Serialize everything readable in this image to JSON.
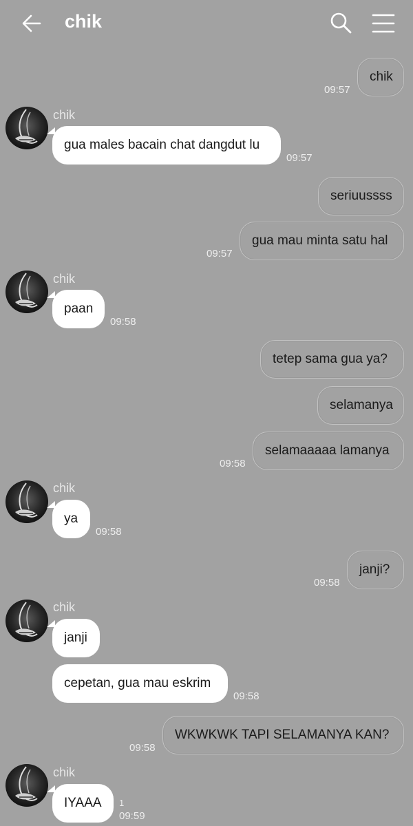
{
  "header": {
    "title": "chik"
  },
  "messages": [
    {
      "dir": "out",
      "text": "chik",
      "time": "09:57"
    },
    {
      "dir": "in",
      "sender": "chik",
      "text": "gua males bacain chat dangdut lu",
      "time": "09:57"
    },
    {
      "dir": "out",
      "text": "seriuussss",
      "time": ""
    },
    {
      "dir": "out",
      "text": "gua mau minta satu hal",
      "time": "09:57"
    },
    {
      "dir": "in",
      "sender": "chik",
      "text": "paan",
      "time": "09:58"
    },
    {
      "dir": "out",
      "text": "tetep sama gua ya?",
      "time": ""
    },
    {
      "dir": "out",
      "text": "selamanya",
      "time": ""
    },
    {
      "dir": "out",
      "text": "selamaaaaa lamanya",
      "time": "09:58"
    },
    {
      "dir": "in",
      "sender": "chik",
      "text": "ya",
      "time": "09:58"
    },
    {
      "dir": "out",
      "text": "janji?",
      "time": "09:58"
    },
    {
      "dir": "in",
      "sender": "chik",
      "text": "janji",
      "time": ""
    },
    {
      "dir": "in",
      "text": "cepetan, gua mau eskrim",
      "time": "09:58"
    },
    {
      "dir": "out",
      "text": "WKWKWK TAPI SELAMANYA KAN?",
      "time": "09:58"
    },
    {
      "dir": "in",
      "sender": "chik",
      "text": "IYAAA",
      "time": "09:59",
      "read_count": "1"
    }
  ],
  "colors": {
    "background": "#a2a2a2",
    "incoming_bubble": "#ffffff",
    "outgoing_bubble": "#a2a2a2"
  }
}
